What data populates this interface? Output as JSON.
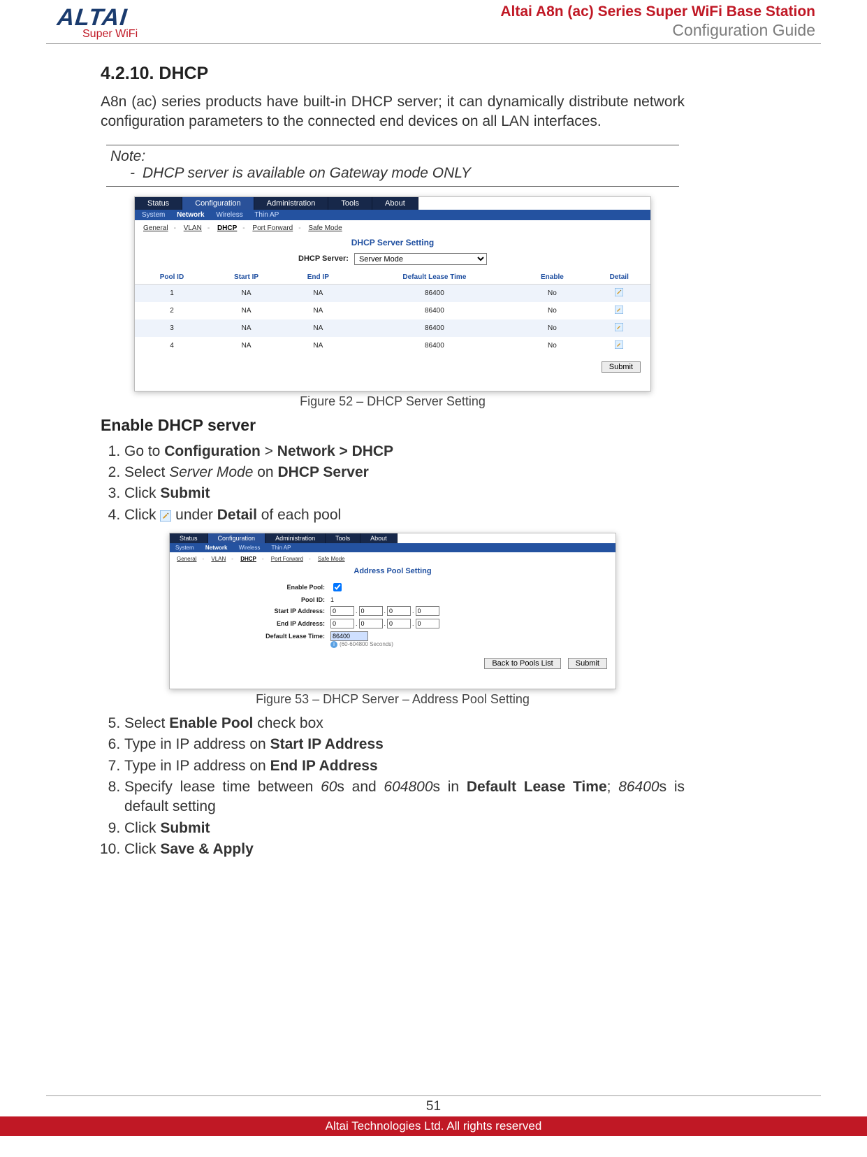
{
  "header": {
    "logo_main": "ALTAI",
    "logo_sub": "Super WiFi",
    "title_line1": "Altai A8n (ac) Series Super WiFi Base Station",
    "title_line2": "Configuration Guide"
  },
  "section": {
    "heading": "4.2.10.   DHCP",
    "intro": "A8n (ac) series products have built-in DHCP server; it can dynamically distribute network configuration parameters to the connected end devices on all LAN interfaces.",
    "note_label": "Note:",
    "note_item": "DHCP server is available on Gateway mode ONLY"
  },
  "fig52": {
    "caption": "Figure 52 – DHCP Server Setting",
    "tabs": [
      "Status",
      "Configuration",
      "Administration",
      "Tools",
      "About"
    ],
    "active_tab": 1,
    "subnav": [
      "System",
      "Network",
      "Wireless",
      "Thin AP"
    ],
    "subnav_selected": 1,
    "crumbs": [
      "General",
      "VLAN",
      "DHCP",
      "Port Forward",
      "Safe Mode"
    ],
    "crumbs_selected": 2,
    "title": "DHCP Server Setting",
    "server_label": "DHCP Server:",
    "server_value": "Server Mode",
    "table": {
      "headers": [
        "Pool ID",
        "Start IP",
        "End IP",
        "Default Lease Time",
        "Enable",
        "Detail"
      ],
      "rows": [
        {
          "id": "1",
          "start": "NA",
          "end": "NA",
          "lease": "86400",
          "enable": "No"
        },
        {
          "id": "2",
          "start": "NA",
          "end": "NA",
          "lease": "86400",
          "enable": "No"
        },
        {
          "id": "3",
          "start": "NA",
          "end": "NA",
          "lease": "86400",
          "enable": "No"
        },
        {
          "id": "4",
          "start": "NA",
          "end": "NA",
          "lease": "86400",
          "enable": "No"
        }
      ]
    },
    "submit": "Submit"
  },
  "enable": {
    "heading": "Enable DHCP server",
    "steps_a": {
      "s1_pre": "Go to ",
      "s1_b1": "Configuration",
      "s1_gt": " > ",
      "s1_b2": "Network > DHCP",
      "s2_pre": "Select ",
      "s2_it": "Server Mode",
      "s2_mid": " on ",
      "s2_b": "DHCP Server",
      "s3_pre": "Click ",
      "s3_b": "Submit",
      "s4_pre": "Click ",
      "s4_mid": " under ",
      "s4_b": "Detail",
      "s4_post": " of each pool"
    }
  },
  "fig53": {
    "caption": "Figure 53 – DHCP Server – Address Pool Setting",
    "tabs": [
      "Status",
      "Configuration",
      "Administration",
      "Tools",
      "About"
    ],
    "active_tab": 1,
    "subnav": [
      "System",
      "Network",
      "Wireless",
      "Thin AP"
    ],
    "subnav_selected": 1,
    "crumbs": [
      "General",
      "VLAN",
      "DHCP",
      "Port Forward",
      "Safe Mode"
    ],
    "crumbs_selected": 2,
    "title": "Address Pool Setting",
    "labels": {
      "enable_pool": "Enable Pool:",
      "pool_id": "Pool ID:",
      "start_ip": "Start IP Address:",
      "end_ip": "End IP Address:",
      "lease": "Default Lease Time:"
    },
    "values": {
      "pool_id": "1",
      "ip_octet": "0",
      "lease": "86400",
      "hint": "(60-604800 Seconds)"
    },
    "buttons": {
      "back": "Back to Pools List",
      "submit": "Submit"
    }
  },
  "steps_b": {
    "s5_pre": "Select ",
    "s5_b": "Enable Pool",
    "s5_post": " check box",
    "s6_pre": "Type in IP address on ",
    "s6_b": "Start IP Address",
    "s7_pre": "Type in IP address on ",
    "s7_b": "End IP Address",
    "s8_pre": "Specify lease time between ",
    "s8_i1": "60",
    "s8_mid1": "s and ",
    "s8_i2": "604800",
    "s8_mid2": "s in ",
    "s8_b": "Default Lease Time",
    "s8_semi": "; ",
    "s8_i3": "86400",
    "s8_post": "s is default setting",
    "s9_pre": "Click ",
    "s9_b": "Submit",
    "s10_pre": "Click ",
    "s10_b": "Save & Apply"
  },
  "footer": {
    "page": "51",
    "copyright": "Altai Technologies Ltd. All rights reserved"
  }
}
